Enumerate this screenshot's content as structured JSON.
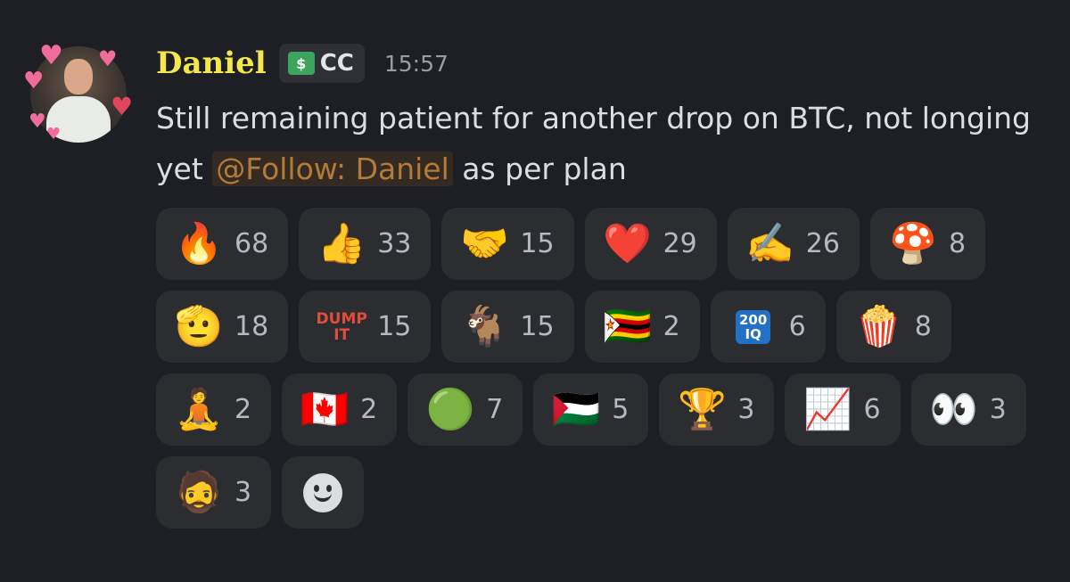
{
  "message": {
    "author": {
      "name": "Daniel",
      "name_color": "#f4e64d",
      "role_tag": "CC",
      "role_icon": "money-icon"
    },
    "timestamp": "15:57",
    "content": {
      "text_before": "Still remaining patient for another drop on BTC, not longing yet ",
      "mention": "@Follow: Daniel",
      "text_after": " as per plan"
    }
  },
  "reactions": [
    {
      "emoji": "🔥",
      "icon": "fire-icon",
      "count": "68"
    },
    {
      "emoji": "👍",
      "icon": "thumbs-up-icon",
      "count": "33"
    },
    {
      "emoji": "🤝",
      "icon": "handshake-icon",
      "count": "15"
    },
    {
      "emoji": "❤️",
      "icon": "heart-icon",
      "count": "29"
    },
    {
      "emoji": "✍️",
      "icon": "writing-hand-icon",
      "count": "26"
    },
    {
      "emoji": "🍄",
      "icon": "mushroom-icon",
      "count": "8"
    },
    {
      "emoji": "🫡",
      "icon": "saluting-face-icon",
      "count": "18"
    },
    {
      "emoji": "DUMP IT",
      "icon": "dump-it-icon",
      "count": "15",
      "text_badge": true
    },
    {
      "emoji": "🐐",
      "icon": "goat-icon",
      "count": "15"
    },
    {
      "emoji": "🇿🇼",
      "icon": "zimbabwe-flag-icon",
      "count": "2"
    },
    {
      "emoji": "200 IQ",
      "icon": "200-iq-icon",
      "count": "6",
      "iq_badge": true
    },
    {
      "emoji": "🍿",
      "icon": "popcorn-icon",
      "count": "8"
    },
    {
      "emoji": "🧘",
      "icon": "meditating-person-icon",
      "count": "2"
    },
    {
      "emoji": "🇨🇦",
      "icon": "canada-flag-icon",
      "count": "2"
    },
    {
      "emoji": "🟢",
      "icon": "lightsaber-icon",
      "count": "7"
    },
    {
      "emoji": "🇵🇸",
      "icon": "palestine-flag-icon",
      "count": "5"
    },
    {
      "emoji": "🏆",
      "icon": "trophies-icon",
      "count": "3"
    },
    {
      "emoji": "📈",
      "icon": "chart-champions-logo-icon",
      "count": "6"
    },
    {
      "emoji": "👀",
      "icon": "eyes-icon",
      "count": "3"
    },
    {
      "emoji": "🧔",
      "icon": "yes-chad-icon",
      "count": "3"
    }
  ],
  "add_reaction": {
    "icon": "add-reaction-smiley-icon"
  },
  "colors": {
    "background": "#1e1f24",
    "reaction_bg": "#2b2d31",
    "mention_bg": "#332a21",
    "mention_text": "#b47a3a"
  }
}
